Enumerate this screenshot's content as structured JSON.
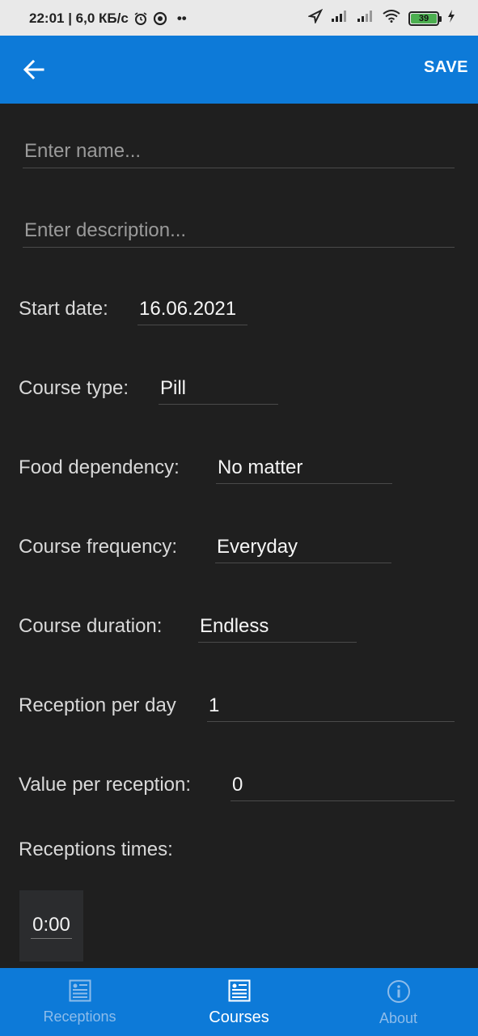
{
  "status_bar": {
    "time_info": "22:01 | 6,0 КБ/с",
    "dots": "••",
    "battery": "39"
  },
  "app_bar": {
    "back_icon": "arrow-left-icon",
    "save_label": "SAVE"
  },
  "form": {
    "name_placeholder": "Enter name...",
    "description_placeholder": "Enter description...",
    "start_date": {
      "label": "Start date:",
      "value": "16.06.2021"
    },
    "course_type": {
      "label": "Course type:",
      "value": "Pill"
    },
    "food_dependency": {
      "label": "Food dependency:",
      "value": "No matter"
    },
    "course_frequency": {
      "label": "Course frequency:",
      "value": "Everyday"
    },
    "course_duration": {
      "label": "Course duration:",
      "value": "Endless"
    },
    "reception_per_day": {
      "label": "Reception per day",
      "value": "1"
    },
    "value_per_reception": {
      "label": "Value per reception:",
      "value": "0"
    },
    "receptions_times_label": "Receptions times:",
    "times": [
      "0:00"
    ]
  },
  "bottom_nav": {
    "items": [
      {
        "label": "Receptions",
        "icon": "document-list-icon",
        "active": false
      },
      {
        "label": "Courses",
        "icon": "document-list-icon",
        "active": true
      },
      {
        "label": "About",
        "icon": "info-circle-icon",
        "active": false
      }
    ]
  },
  "colors": {
    "primary": "#0d7ad8",
    "background": "#1f1f1f",
    "inactive_nav": "#8dbcea"
  }
}
